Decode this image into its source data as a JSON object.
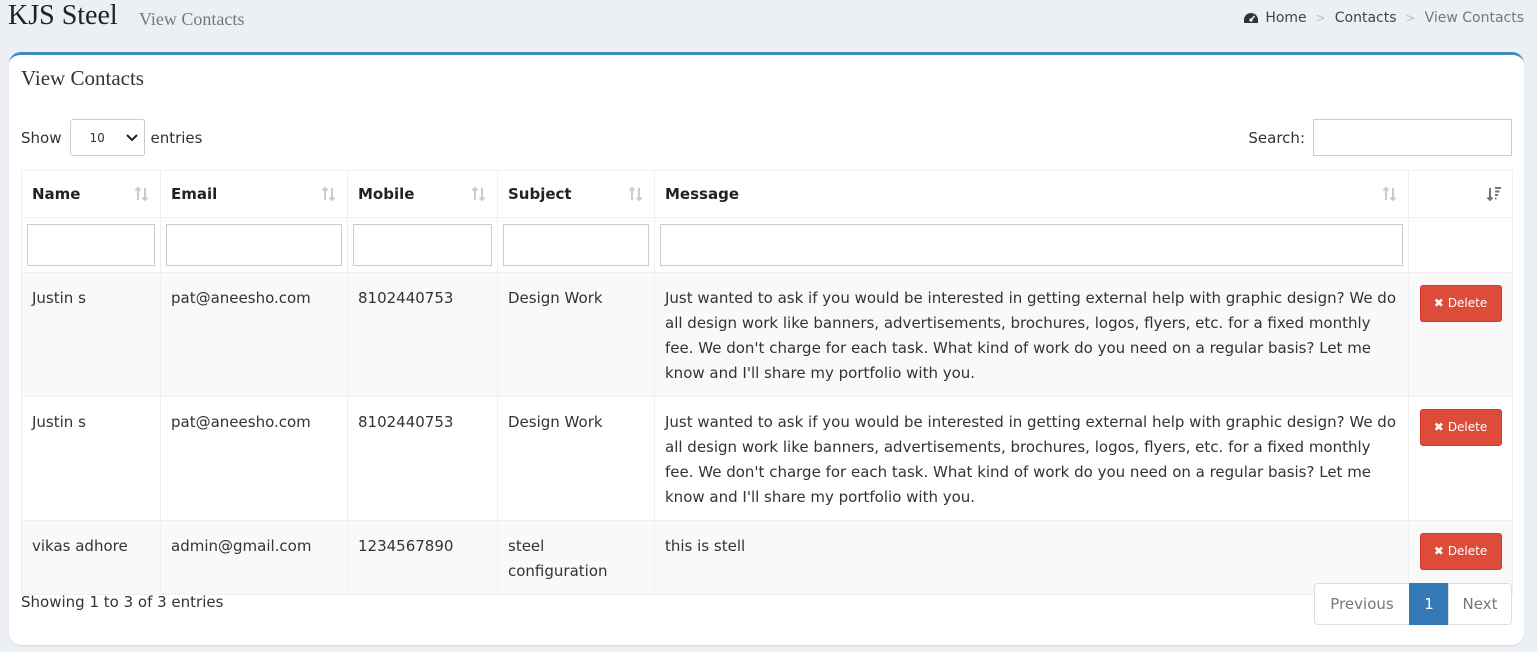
{
  "header": {
    "brand": "KJS Steel",
    "subtitle": "View Contacts",
    "breadcrumb": [
      {
        "label": "Home",
        "icon": "dashboard-icon"
      },
      {
        "label": "Contacts"
      },
      {
        "label": "View Contacts"
      }
    ]
  },
  "box": {
    "title": "View Contacts"
  },
  "length": {
    "show_label": "Show",
    "selected": "10",
    "entries_label": "entries"
  },
  "search": {
    "label": "Search:",
    "value": ""
  },
  "table": {
    "columns": [
      "Name",
      "Email",
      "Mobile",
      "Subject",
      "Message",
      ""
    ],
    "rows": [
      {
        "name": "Justin s",
        "email": "pat@aneesho.com",
        "mobile": "8102440753",
        "subject": "Design Work",
        "message": "Just wanted to ask if you would be interested in getting external help with graphic design? We do all design work like banners, advertisements, brochures, logos, flyers, etc. for a fixed monthly fee. We don't charge for each task. What kind of work do you need on a regular basis? Let me know and I'll share my portfolio with you.",
        "action": "Delete"
      },
      {
        "name": "Justin s",
        "email": "pat@aneesho.com",
        "mobile": "8102440753",
        "subject": "Design Work",
        "message": "Just wanted to ask if you would be interested in getting external help with graphic design? We do all design work like banners, advertisements, brochures, logos, flyers, etc. for a fixed monthly fee. We don't charge for each task. What kind of work do you need on a regular basis? Let me know and I'll share my portfolio with you.",
        "action": "Delete"
      },
      {
        "name": "vikas adhore",
        "email": "admin@gmail.com",
        "mobile": "1234567890",
        "subject": "steel configuration",
        "message": "this is stell",
        "action": "Delete"
      }
    ]
  },
  "footer": {
    "info": "Showing 1 to 3 of 3 entries",
    "prev": "Previous",
    "page": "1",
    "next": "Next"
  },
  "colors": {
    "accent": "#3c8dbc",
    "danger": "#dd4b39",
    "page_active": "#337ab7"
  }
}
